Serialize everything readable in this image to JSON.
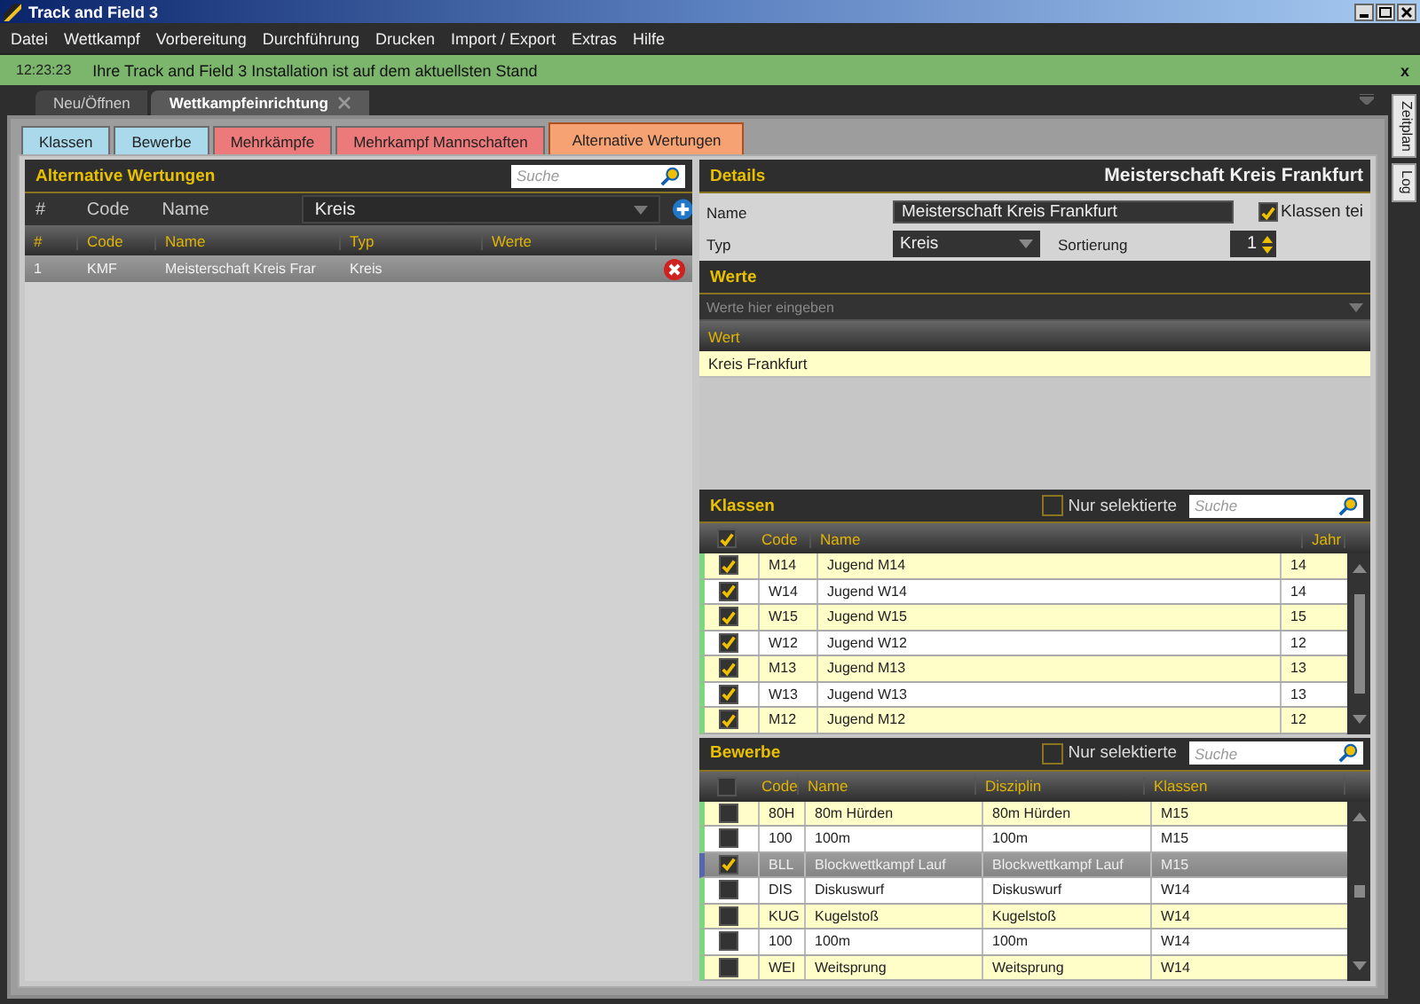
{
  "window": {
    "title": "Track and Field 3"
  },
  "menu": [
    "Datei",
    "Wettkampf",
    "Vorbereitung",
    "Durchführung",
    "Drucken",
    "Import / Export",
    "Extras",
    "Hilfe"
  ],
  "notification": {
    "time": "12:23:23",
    "message": "Ihre Track and Field 3 Installation ist auf dem aktuellsten Stand",
    "close": "x"
  },
  "doc_tabs": [
    {
      "label": "Neu/Öffnen",
      "selected": false,
      "closable": false
    },
    {
      "label": "Wettkampfeinrichtung",
      "selected": true,
      "closable": true
    }
  ],
  "side_tabs": [
    "Zeitplan",
    "Log"
  ],
  "tabs": [
    {
      "label": "Klassen",
      "selected": false,
      "color": "#a9d9ea"
    },
    {
      "label": "Bewerbe",
      "selected": false,
      "color": "#a9d9ea"
    },
    {
      "label": "Mehrkämpfe",
      "selected": false,
      "color": "#ec7a7a"
    },
    {
      "label": "Mehrkampf Mannschaften",
      "selected": false,
      "color": "#ec7a7a"
    },
    {
      "label": "Alternative Wertungen",
      "selected": true,
      "color": "#f7a272"
    }
  ],
  "list": {
    "title": "Alternative Wertungen",
    "search_placeholder": "Suche",
    "filter_labels": [
      "#",
      "Code",
      "Name"
    ],
    "filter_value": "Kreis",
    "columns": [
      "#",
      "Code",
      "Name",
      "Typ",
      "Werte"
    ],
    "rows": [
      {
        "num": "1",
        "code": "KMF",
        "name": "Meisterschaft Kreis Frar",
        "typ": "Kreis",
        "selected": true
      }
    ]
  },
  "details": {
    "title": "Details",
    "heading": "Meisterschaft Kreis Frankfurt",
    "name_label": "Name",
    "name_value": "Meisterschaft Kreis Frankfurt",
    "typ_label": "Typ",
    "typ_value": "Kreis",
    "sort_label": "Sortierung",
    "sort_value": "1",
    "option": {
      "label": "Klassen tei",
      "checked": true
    }
  },
  "werte": {
    "title": "Werte",
    "placeholder": "Werte hier eingeben",
    "column": "Wert",
    "rows": [
      "Kreis Frankfurt"
    ]
  },
  "klassen": {
    "title": "Klassen",
    "filter": {
      "label": "Nur selektierte",
      "checked": false
    },
    "search_placeholder": "Suche",
    "all_checked": true,
    "columns": [
      "Code",
      "Name",
      "Jahr"
    ],
    "rows": [
      {
        "checked": true,
        "selected": false,
        "cells": [
          "M14",
          "Jugend M14",
          "14"
        ]
      },
      {
        "checked": true,
        "selected": false,
        "cells": [
          "W14",
          "Jugend W14",
          "14"
        ]
      },
      {
        "checked": true,
        "selected": false,
        "cells": [
          "W15",
          "Jugend W15",
          "15"
        ]
      },
      {
        "checked": true,
        "selected": false,
        "cells": [
          "W12",
          "Jugend W12",
          "12"
        ]
      },
      {
        "checked": true,
        "selected": false,
        "cells": [
          "M13",
          "Jugend M13",
          "13"
        ]
      },
      {
        "checked": true,
        "selected": false,
        "cells": [
          "W13",
          "Jugend W13",
          "13"
        ]
      },
      {
        "checked": true,
        "selected": false,
        "cells": [
          "M12",
          "Jugend M12",
          "12"
        ]
      }
    ]
  },
  "bewerbe": {
    "title": "Bewerbe",
    "filter": {
      "label": "Nur selektierte",
      "checked": false
    },
    "search_placeholder": "Suche",
    "all_checked": false,
    "columns": [
      "Code",
      "Name",
      "Disziplin",
      "Klassen"
    ],
    "rows": [
      {
        "checked": false,
        "selected": false,
        "cells": [
          "80H",
          "80m Hürden",
          "80m Hürden",
          "M15"
        ]
      },
      {
        "checked": false,
        "selected": false,
        "cells": [
          "100",
          "100m",
          "100m",
          "M15"
        ]
      },
      {
        "checked": true,
        "selected": true,
        "cells": [
          "BLL",
          "Blockwettkampf Lauf",
          "Blockwettkampf Lauf",
          "M15"
        ]
      },
      {
        "checked": false,
        "selected": false,
        "cells": [
          "DIS",
          "Diskuswurf",
          "Diskuswurf",
          "W14"
        ]
      },
      {
        "checked": false,
        "selected": false,
        "cells": [
          "KUG",
          "Kugelstoß",
          "Kugelstoß",
          "W14"
        ]
      },
      {
        "checked": false,
        "selected": false,
        "cells": [
          "100",
          "100m",
          "100m",
          "W14"
        ]
      },
      {
        "checked": false,
        "selected": false,
        "cells": [
          "WEI",
          "Weitsprung",
          "Weitsprung",
          "W14"
        ]
      }
    ]
  }
}
